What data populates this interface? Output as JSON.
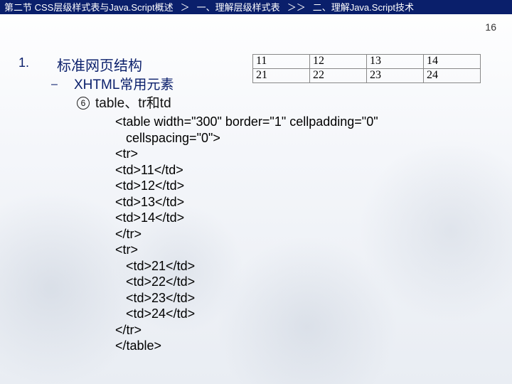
{
  "breadcrumb": {
    "section": "第二节 CSS层级样式表与Java.Script概述",
    "sep1": "＞",
    "item1": "一、理解层级样式表",
    "sep2": "＞＞",
    "item2": "二、理解Java.Script技术"
  },
  "outline": {
    "num": "1.",
    "h1": "标准网页结构",
    "dash": "–",
    "h2": "XHTML常用元素",
    "circled": "6",
    "h3": "table、tr和td"
  },
  "example": {
    "rows": [
      [
        "11",
        "12",
        "13",
        "14"
      ],
      [
        "21",
        "22",
        "23",
        "24"
      ]
    ]
  },
  "code_lines": [
    "<table width=\"300\" border=\"1\" cellpadding=\"0\"",
    "   cellspacing=\"0\">",
    "<tr>",
    "<td>11</td>",
    "<td>12</td>",
    "<td>13</td>",
    "<td>14</td>",
    "</tr>",
    "<tr>",
    "   <td>21</td>",
    "   <td>22</td>",
    "   <td>23</td>",
    "   <td>24</td>",
    "</tr>",
    "</table>"
  ],
  "page_number": "16"
}
